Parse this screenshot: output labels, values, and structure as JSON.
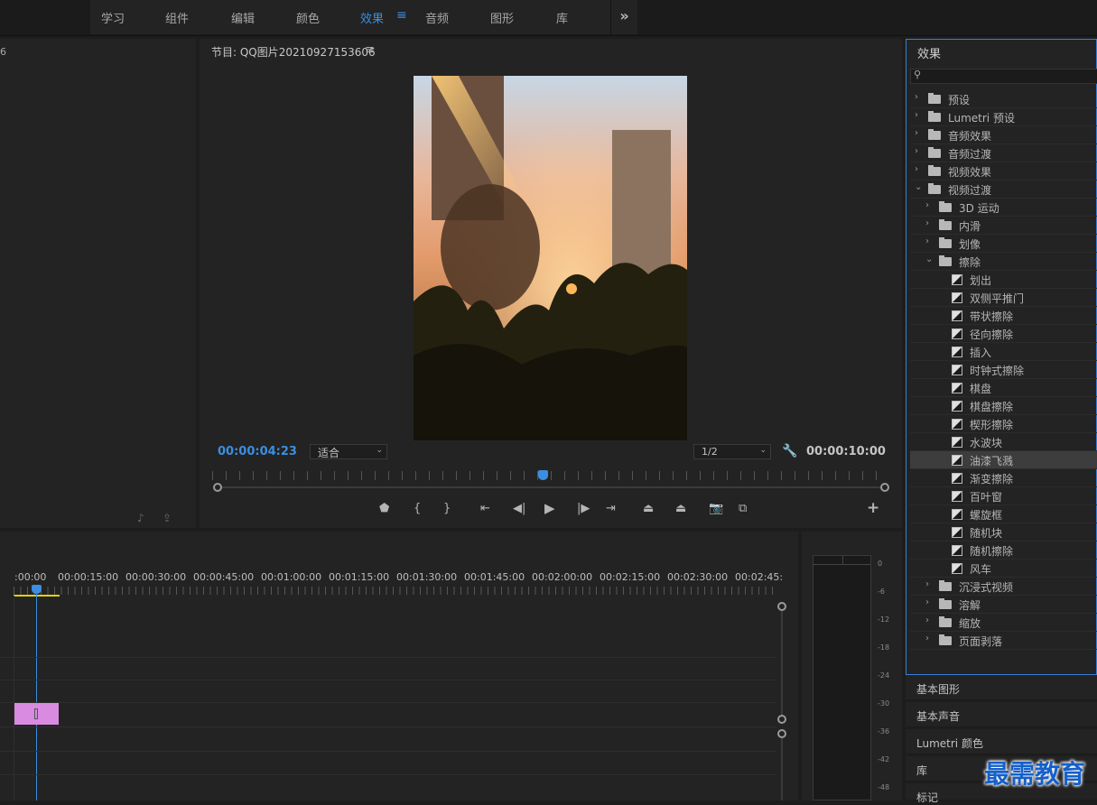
{
  "workspace_tabs": [
    "学习",
    "组件",
    "编辑",
    "颜色",
    "效果",
    "音频",
    "图形",
    "库"
  ],
  "workspace_active_index": 4,
  "workspace_menu_icon": "hamburger-icon",
  "more_icon": "double-chevron-right-icon",
  "left_panel": {
    "fragment": "6"
  },
  "program_monitor": {
    "title": "节目: QQ图片20210927153606",
    "menu_icon": "≡",
    "current_time": "00:00:04:23",
    "fit": "适合",
    "resolution": "1/2",
    "duration": "00:00:10:00",
    "playhead_fraction": 0.5,
    "controls": [
      "marker-icon",
      "mark-in-icon",
      "mark-out-icon",
      "go-to-in-icon",
      "step-back-icon",
      "play-icon",
      "step-forward-icon",
      "go-to-out-icon",
      "lift-icon",
      "extract-icon",
      "export-frame-icon",
      "comparison-view-icon",
      "add-button-icon"
    ]
  },
  "effects_panel": {
    "title": "效果",
    "search_icon": "search-icon",
    "items": [
      {
        "label": "预设",
        "level": 0,
        "type": "folder-star",
        "open": false
      },
      {
        "label": "Lumetri 预设",
        "level": 0,
        "type": "folder-star",
        "open": false
      },
      {
        "label": "音频效果",
        "level": 0,
        "type": "folder",
        "open": false
      },
      {
        "label": "音频过渡",
        "level": 0,
        "type": "folder",
        "open": false
      },
      {
        "label": "视频效果",
        "level": 0,
        "type": "folder",
        "open": false
      },
      {
        "label": "视频过渡",
        "level": 0,
        "type": "folder",
        "open": true
      },
      {
        "label": "3D 运动",
        "level": 1,
        "type": "folder",
        "open": false
      },
      {
        "label": "内滑",
        "level": 1,
        "type": "folder",
        "open": false
      },
      {
        "label": "划像",
        "level": 1,
        "type": "folder",
        "open": false
      },
      {
        "label": "擦除",
        "level": 1,
        "type": "folder",
        "open": true
      },
      {
        "label": "划出",
        "level": 2,
        "type": "transition"
      },
      {
        "label": "双侧平推门",
        "level": 2,
        "type": "transition"
      },
      {
        "label": "带状擦除",
        "level": 2,
        "type": "transition"
      },
      {
        "label": "径向擦除",
        "level": 2,
        "type": "transition"
      },
      {
        "label": "插入",
        "level": 2,
        "type": "transition"
      },
      {
        "label": "时钟式擦除",
        "level": 2,
        "type": "transition"
      },
      {
        "label": "棋盘",
        "level": 2,
        "type": "transition"
      },
      {
        "label": "棋盘擦除",
        "level": 2,
        "type": "transition"
      },
      {
        "label": "楔形擦除",
        "level": 2,
        "type": "transition"
      },
      {
        "label": "水波块",
        "level": 2,
        "type": "transition"
      },
      {
        "label": "油漆飞溅",
        "level": 2,
        "type": "transition",
        "selected": true
      },
      {
        "label": "渐变擦除",
        "level": 2,
        "type": "transition"
      },
      {
        "label": "百叶窗",
        "level": 2,
        "type": "transition"
      },
      {
        "label": "螺旋框",
        "level": 2,
        "type": "transition"
      },
      {
        "label": "随机块",
        "level": 2,
        "type": "transition"
      },
      {
        "label": "随机擦除",
        "level": 2,
        "type": "transition"
      },
      {
        "label": "风车",
        "level": 2,
        "type": "transition"
      },
      {
        "label": "沉浸式视频",
        "level": 1,
        "type": "folder",
        "open": false
      },
      {
        "label": "溶解",
        "level": 1,
        "type": "folder",
        "open": false
      },
      {
        "label": "缩放",
        "level": 1,
        "type": "folder",
        "open": false
      },
      {
        "label": "页面剥落",
        "level": 1,
        "type": "folder",
        "open": false
      }
    ]
  },
  "side_sections": [
    "基本图形",
    "基本声音",
    "Lumetri 颜色",
    "库",
    "标记"
  ],
  "timeline": {
    "timecodes": [
      ":00:00",
      "00:00:15:00",
      "00:00:30:00",
      "00:00:45:00",
      "00:01:00:00",
      "00:01:15:00",
      "00:01:30:00",
      "00:01:45:00",
      "00:02:00:00",
      "00:02:15:00",
      "00:02:30:00",
      "00:02:45:"
    ],
    "clip_color": "#d88be0"
  },
  "audio_meter": {
    "db_labels": [
      "0",
      "-6",
      "-12",
      "-18",
      "-24",
      "-30",
      "-36",
      "-42",
      "-48"
    ]
  },
  "watermark": "最需教育",
  "colors": {
    "accent": "#3b8ee0",
    "panel": "#232323",
    "panel_border": "#3a7fd5",
    "watermark": "#1560c9"
  }
}
